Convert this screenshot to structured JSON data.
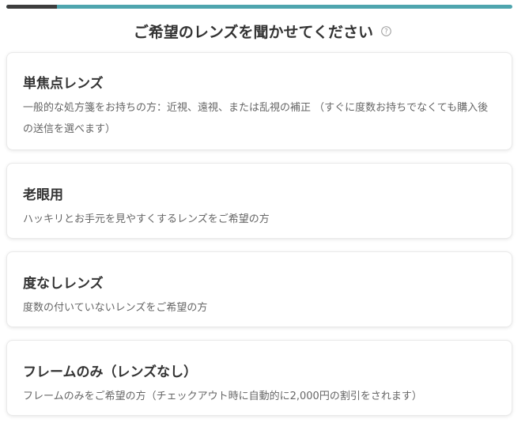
{
  "progress": {
    "value_fraction": 0.1,
    "fill_color": "#3d3d3d",
    "track_color": "#4fa5ae"
  },
  "header": {
    "title": "ご希望のレンズを聞かせてください",
    "help_icon": "question-circle-icon"
  },
  "options": [
    {
      "title": "単焦点レンズ",
      "description": "一般的な処方箋をお持ちの方：近視、遠視、または乱視の補正 （すぐに度数お持ちでなくても購入後の送信を選べます）"
    },
    {
      "title": "老眼用",
      "description": "ハッキリとお手元を見やすくするレンズをご希望の方"
    },
    {
      "title": "度なしレンズ",
      "description": "度数の付いていないレンズをご希望の方"
    },
    {
      "title": "フレームのみ（レンズなし）",
      "description": "フレームのみをご希望の方（チェックアウト時に自動的に2,000円の割引をされます）"
    }
  ]
}
